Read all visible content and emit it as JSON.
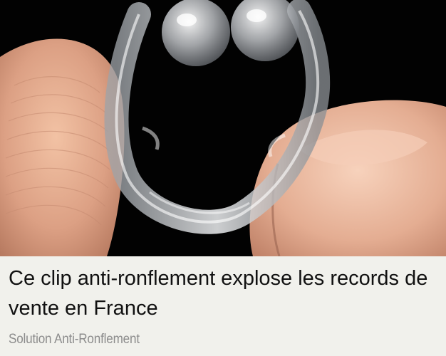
{
  "ad": {
    "image": {
      "icon": "nose-clip-photo",
      "depicts": "clear silicone anti-snoring nose clip held between fingers"
    },
    "headline": "Ce clip anti-ronflement explose les records de vente en France",
    "source": "Solution Anti-Ronflement"
  },
  "colors": {
    "background": "#f1f1ec",
    "headline": "#111111",
    "source": "#8c8c8c",
    "image_background": "#000000"
  }
}
